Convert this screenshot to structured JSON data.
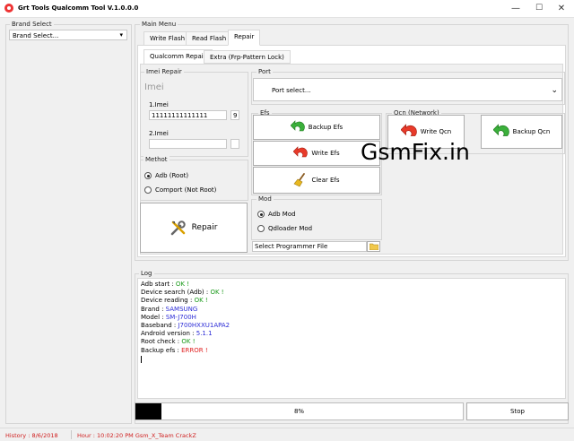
{
  "window": {
    "title": "Grt Tools Qualcomm Tool V.1.0.0.0",
    "controls": [
      "—",
      "☐",
      "✕"
    ]
  },
  "brand": {
    "group_title": "Brand Select",
    "selected": "Brand Select..."
  },
  "main_menu": {
    "group_title": "Main Menu",
    "tabs": [
      "Write Flash",
      "Read Flash",
      "Repair"
    ],
    "active_tab": "Repair",
    "subtabs": [
      "Qualcomm Repair",
      "Extra (Frp-Pattern Lock)"
    ]
  },
  "imei_repair": {
    "group_title": "Imei Repair",
    "heading": "Imei",
    "imei1_label": "1.Imei",
    "imei1_value": "11111111111111",
    "imei1_check": "9",
    "imei2_label": "2.Imei",
    "imei2_value": "",
    "imei2_check": ""
  },
  "method": {
    "group_title": "Methot",
    "options": [
      "Adb (Root)",
      "Comport (Not Root)"
    ],
    "selected": "Adb (Root)"
  },
  "repair_button": "Repair",
  "port": {
    "group_title": "Port",
    "selected": "Port select..."
  },
  "efs": {
    "group_title": "Efs",
    "backup": "Backup Efs",
    "write": "Write Efs",
    "clear": "Clear Efs"
  },
  "qcn": {
    "group_title": "Qcn (Network)",
    "write": "Write Qcn",
    "backup": "Backup Qcn"
  },
  "mod": {
    "group_title": "Mod",
    "options": [
      "Adb Mod",
      "Qdloader Mod"
    ],
    "selected": "Adb Mod"
  },
  "programmer": {
    "placeholder": "Select Programmer File"
  },
  "watermark": "GsmFix.in",
  "log": {
    "group_title": "Log",
    "lines": [
      {
        "label": "Adb start : ",
        "value": "OK !",
        "tone": "ok"
      },
      {
        "label": "Device search (Adb) : ",
        "value": "OK !",
        "tone": "ok"
      },
      {
        "label": "Device reading : ",
        "value": "OK !",
        "tone": "ok"
      },
      {
        "label": "Brand : ",
        "value": "SAMSUNG",
        "tone": "blue"
      },
      {
        "label": "Model : ",
        "value": "SM-J700H",
        "tone": "blue"
      },
      {
        "label": "Baseband : ",
        "value": "J700HXXU1APA2",
        "tone": "blue"
      },
      {
        "label": "Android version : ",
        "value": "5.1.1",
        "tone": "blue"
      },
      {
        "label": "Root check : ",
        "value": "OK !",
        "tone": "ok"
      },
      {
        "label": "Backup efs : ",
        "value": "ERROR !",
        "tone": "err"
      }
    ]
  },
  "progress": {
    "percent": 8,
    "label": "8%"
  },
  "stop_button": "Stop",
  "status": {
    "history": "History : 8/6/2018",
    "hour": "Hour : 10:02:20 PM Gsm_X_Team CrackZ"
  },
  "colors": {
    "ok": "#1a9a1a",
    "value": "#2b2bd6",
    "error": "#e02020",
    "status": "#d02020",
    "progress_fill": "#000000"
  }
}
